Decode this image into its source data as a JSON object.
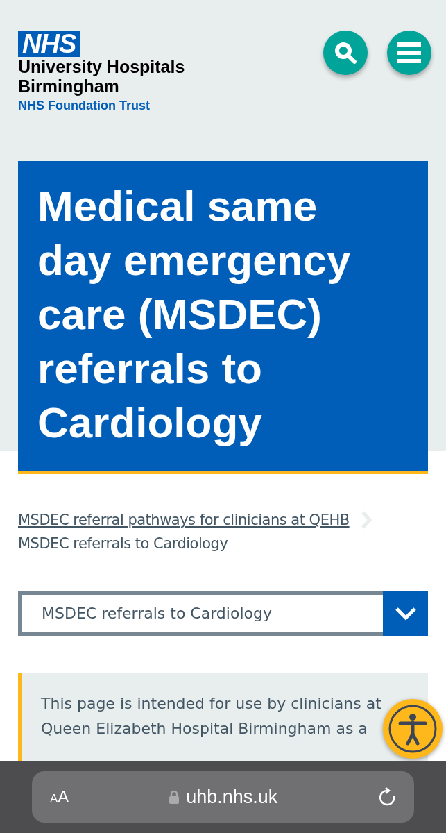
{
  "header": {
    "logo": "NHS",
    "org_name": [
      "University Hospitals",
      "Birmingham"
    ],
    "org_subtitle": "NHS Foundation Trust",
    "buttons": [
      {
        "kind": "search"
      },
      {
        "kind": "menu"
      }
    ]
  },
  "hero": {
    "title": "Medical same day emergency care (MSDEC) referrals to Cardiology"
  },
  "breadcrumb": {
    "link": "MSDEC referral pathways for clinicians at QEHB",
    "current": "MSDEC referrals to Cardiology"
  },
  "page_select": {
    "value": "MSDEC referrals to Cardiology"
  },
  "callout": {
    "text": "This page is intended for use by clinicians at Queen Elizabeth Hospital Birmingham as a"
  },
  "browser_bar": {
    "text_size": [
      "A",
      "A"
    ],
    "url": "uhb.nhs.uk"
  }
}
